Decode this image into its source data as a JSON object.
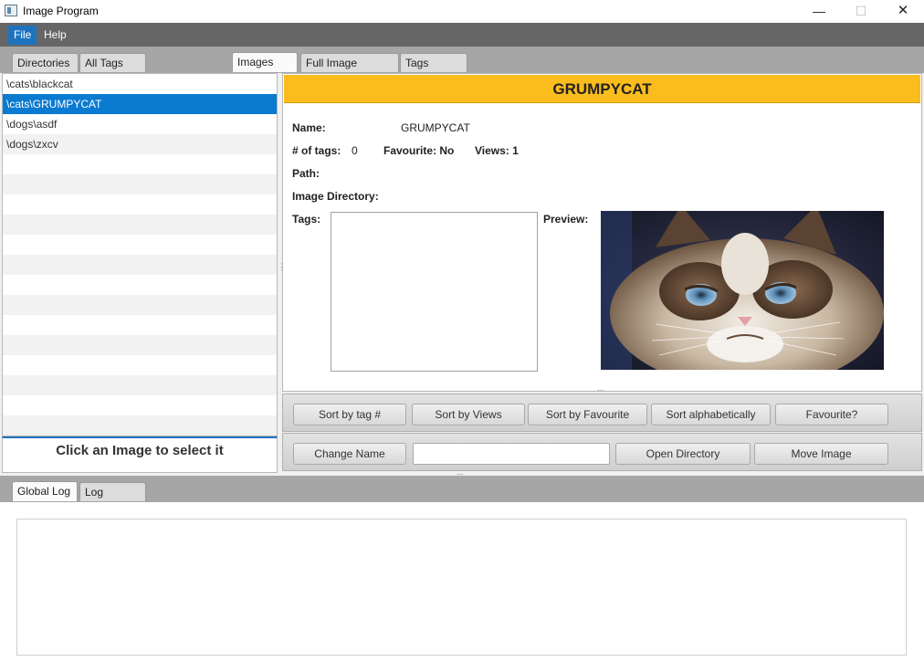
{
  "window": {
    "title": "Image Program",
    "min_glyph": "—",
    "max_glyph": "☐",
    "close_glyph": "✕"
  },
  "menu": {
    "file": "File",
    "help": "Help"
  },
  "left_tabs": [
    {
      "label": "Directories"
    },
    {
      "label": "All Tags"
    }
  ],
  "main_tabs": [
    {
      "label": "Images",
      "active": true
    },
    {
      "label": "Full Image Preview"
    },
    {
      "label": "Tags"
    }
  ],
  "image_list": {
    "items": [
      {
        "label": "\\cats\\blackcat"
      },
      {
        "label": "\\cats\\GRUMPYCAT",
        "selected": true
      },
      {
        "label": "\\dogs\\asdf"
      },
      {
        "label": "\\dogs\\zxcv"
      }
    ],
    "hint": "Click an Image to select it"
  },
  "detail": {
    "header": "GRUMPYCAT",
    "header_color": "#fbbd1d",
    "name_label": "Name:",
    "name_value": "GRUMPYCAT",
    "tags_count_label": "# of tags:",
    "tags_count_value": "0",
    "favourite_label": "Favourite: No",
    "views_label": "Views: 1",
    "path_label": "Path:",
    "directory_label": "Image Directory:",
    "tags_label": "Tags:",
    "preview_label": "Preview:",
    "grip": "..."
  },
  "sort_toolbar": {
    "sort_tag_count": "Sort by tag #",
    "sort_views": "Sort by Views",
    "sort_favourite": "Sort by Favourite",
    "sort_alpha": "Sort alphabetically",
    "favourite": "Favourite?"
  },
  "action_toolbar": {
    "change_name": "Change Name",
    "name_input_value": "",
    "open_directory": "Open Directory",
    "move_image": "Move Image"
  },
  "log_tabs": [
    {
      "label": "Global Log",
      "active": true
    },
    {
      "label": "Log"
    }
  ],
  "log": {
    "text": ""
  },
  "colors": {
    "menubar": "#666666",
    "selection": "#0b7ad1",
    "tabstrip": "#a6a6a6"
  }
}
